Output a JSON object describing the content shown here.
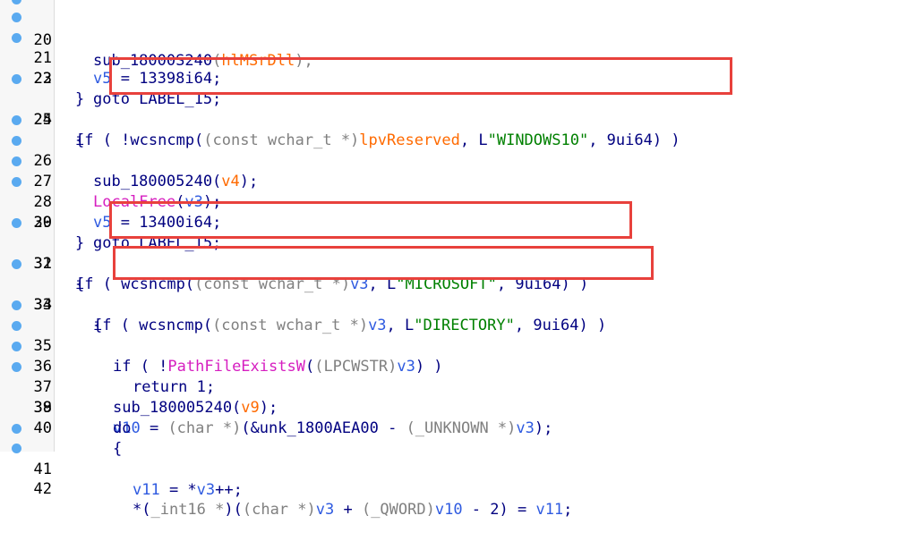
{
  "colors": {
    "gutter_dot": "#5aaaf0",
    "highlight_box": "#e8413c",
    "keyword": "#000080",
    "variable": "#2e5ae0",
    "argument": "#ff6a00",
    "import": "#d61ec0",
    "string": "#008000",
    "type": "#808080"
  },
  "lines": [
    {
      "num": "20",
      "has_dot": true,
      "text": "sub_18000S240(hlMSrDll);"
    },
    {
      "num": "21",
      "has_dot": true,
      "text": "v5 = 13398i64;"
    },
    {
      "num": "22",
      "has_dot": true,
      "text": "goto LABEL_15;"
    },
    {
      "num": "23",
      "has_dot": false,
      "text": "}"
    },
    {
      "num": "24",
      "has_dot": true,
      "text": "if ( !wcsncmp((const wchar_t *)lpvReserved, L\"WINDOWS10\", 9ui64) )"
    },
    {
      "num": "25",
      "has_dot": false,
      "text": "{"
    },
    {
      "num": "26",
      "has_dot": true,
      "text": "sub_180005240(v4);"
    },
    {
      "num": "27",
      "has_dot": true,
      "text": "LocalFree(v3);"
    },
    {
      "num": "28",
      "has_dot": true,
      "text": "v5 = 13400i64;"
    },
    {
      "num": "29",
      "has_dot": true,
      "text": "goto LABEL_15;"
    },
    {
      "num": "30",
      "has_dot": false,
      "text": "}"
    },
    {
      "num": "31",
      "has_dot": true,
      "text": "if ( wcsncmp((const wchar_t *)v3, L\"MICROSOFT\", 9ui64) )"
    },
    {
      "num": "32",
      "has_dot": false,
      "text": "{"
    },
    {
      "num": "33",
      "has_dot": true,
      "text": "if ( wcsncmp((const wchar_t *)v3, L\"DIRECTORY\", 9ui64) )"
    },
    {
      "num": "34",
      "has_dot": false,
      "text": "{"
    },
    {
      "num": "35",
      "has_dot": true,
      "text": "if ( !PathFileExistsW((LPCWSTR)v3) )"
    },
    {
      "num": "36",
      "has_dot": true,
      "text": "return 1;"
    },
    {
      "num": "37",
      "has_dot": true,
      "text": "sub_180005240(v9);"
    },
    {
      "num": "38",
      "has_dot": true,
      "text": "v10 = (char *)(&unk_1800AEA00 - (_UNKNOWN *)v3);"
    },
    {
      "num": "39",
      "has_dot": false,
      "text": "do"
    },
    {
      "num": "40",
      "has_dot": false,
      "text": "{"
    },
    {
      "num": "41",
      "has_dot": true,
      "text": "v11 = *v3++;"
    },
    {
      "num": "42",
      "has_dot": true,
      "text": "*(_int16 *)((char *)v3 + (_QWORD)v10 - 2) = v11;"
    }
  ]
}
